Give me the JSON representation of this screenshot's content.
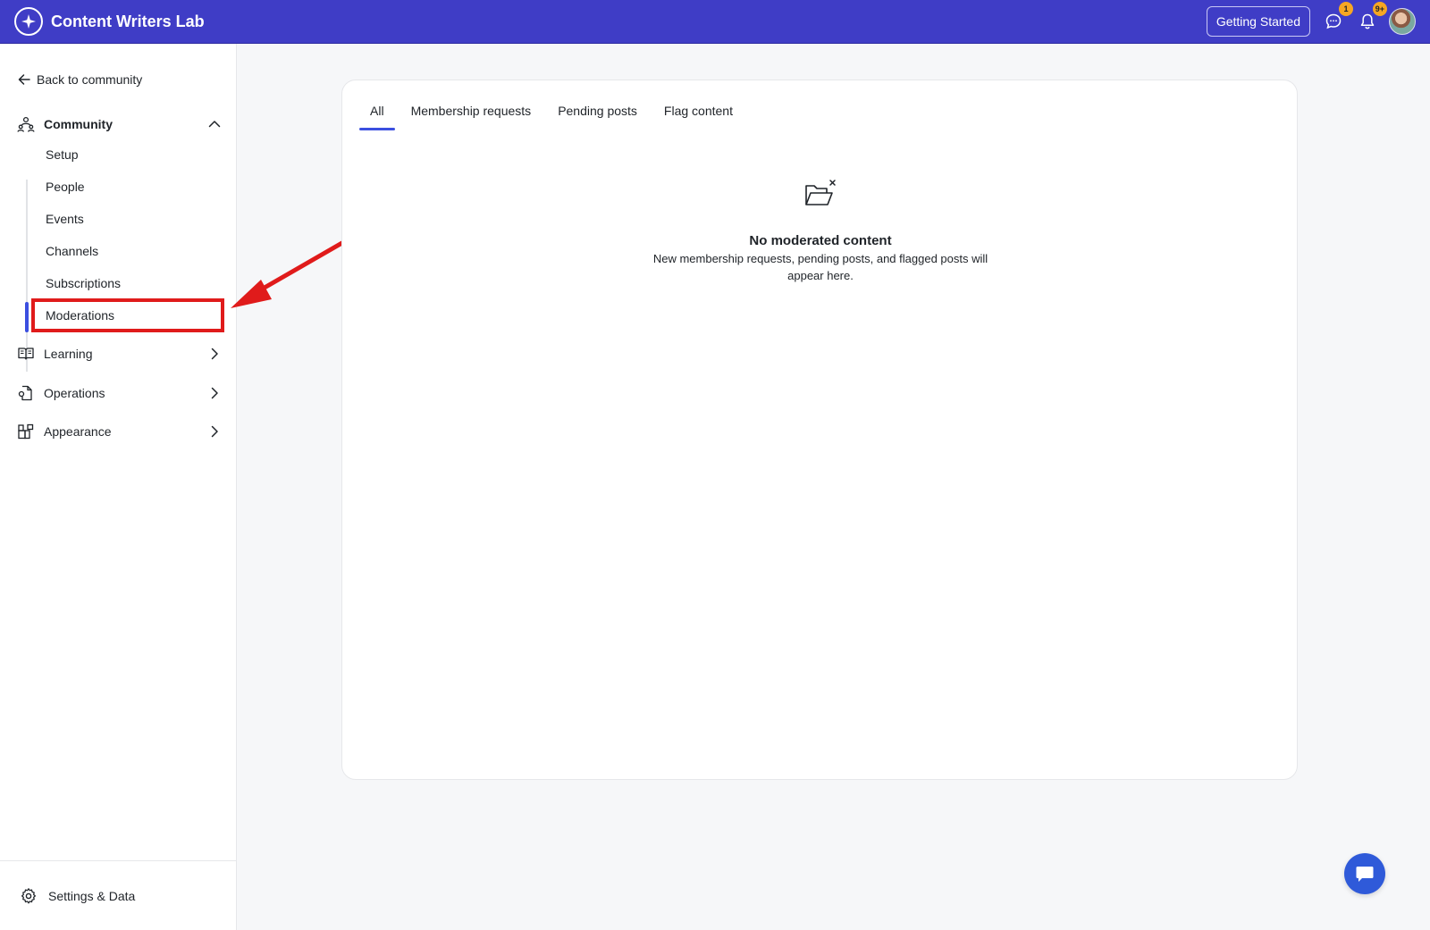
{
  "topbar": {
    "brand_name": "Content Writers Lab",
    "getting_started_label": "Getting Started",
    "messages_badge": "1",
    "notifications_badge": "9+",
    "accent_color": "#3f3dc6"
  },
  "sidebar": {
    "back_label": "Back to community",
    "community_label": "Community",
    "subitems": [
      "Setup",
      "People",
      "Events",
      "Channels",
      "Subscriptions",
      "Moderations"
    ],
    "active_subitem": "Moderations",
    "groups": [
      {
        "label": "Learning",
        "icon": "book-icon"
      },
      {
        "label": "Operations",
        "icon": "document-icon"
      },
      {
        "label": "Appearance",
        "icon": "layout-icon"
      }
    ],
    "settings_label": "Settings & Data"
  },
  "main": {
    "tabs": [
      "All",
      "Membership requests",
      "Pending posts",
      "Flag content"
    ],
    "active_tab": "All",
    "empty_title": "No moderated content",
    "empty_desc": "New membership requests, pending posts, and flagged posts will appear here."
  },
  "annotation": {
    "highlight_color": "#e01b1b"
  }
}
